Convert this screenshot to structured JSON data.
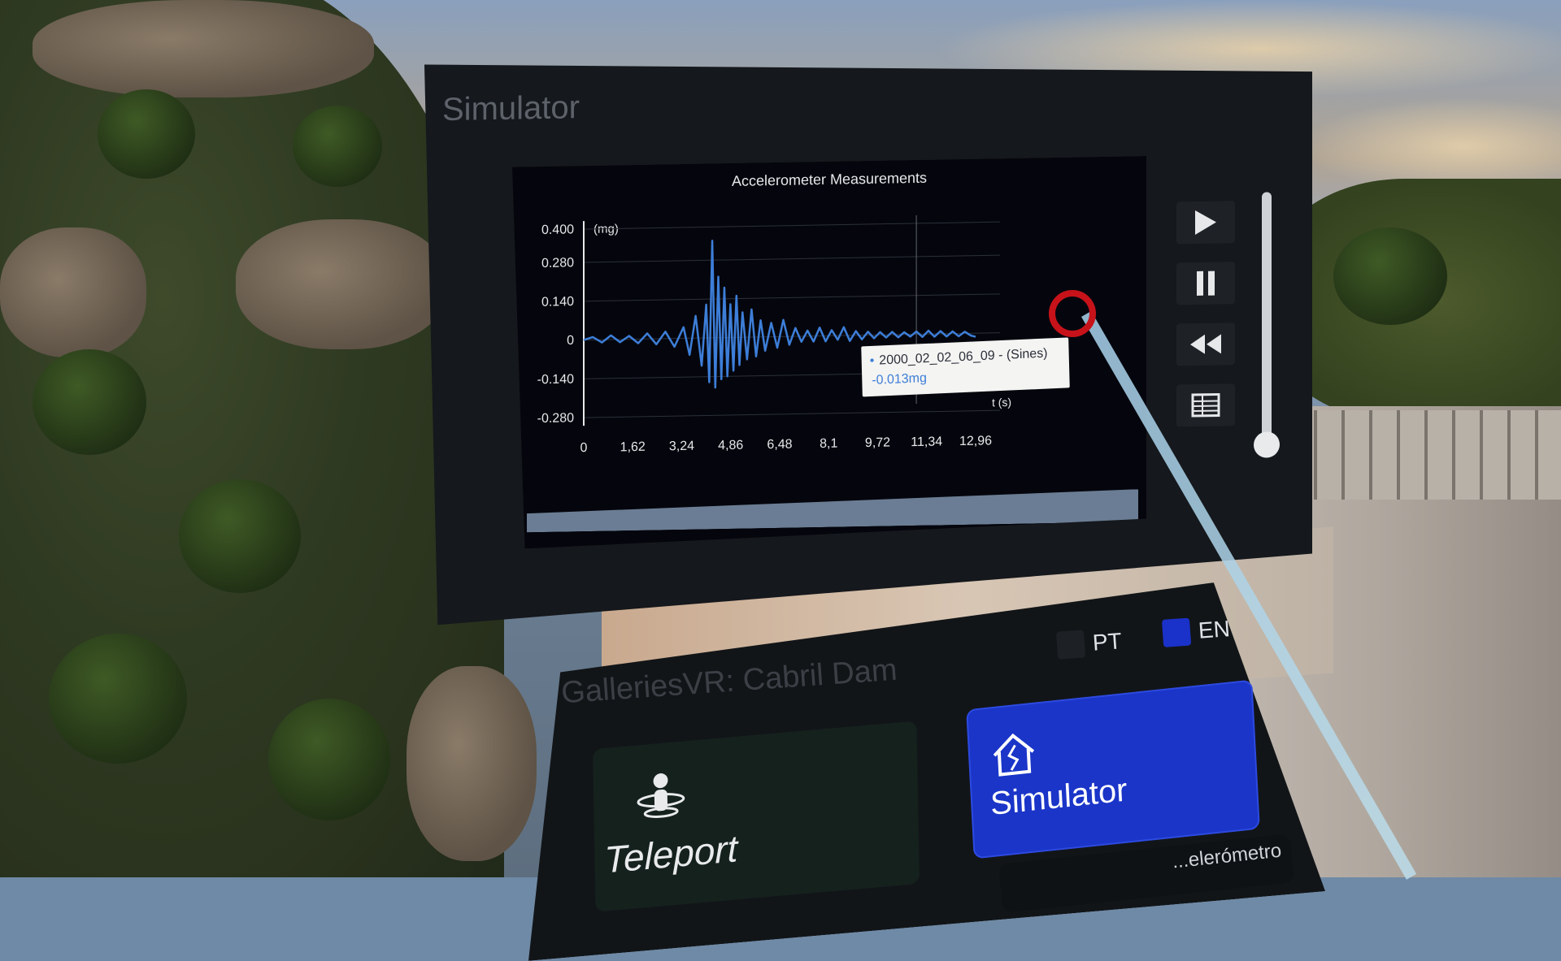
{
  "simulator_panel": {
    "title": "Simulator",
    "controls": {
      "play_icon": "play-icon",
      "pause_icon": "pause-icon",
      "rewind_icon": "rewind-icon",
      "table_icon": "table-icon"
    },
    "volume_slider_level": 0.0
  },
  "chart_data": {
    "type": "line",
    "title": "Accelerometer Measurements",
    "yunit": "(mg)",
    "xunit": "t (s)",
    "y_ticks": [
      "0.400",
      "0.280",
      "0.140",
      "0",
      "-0.140",
      "-0.280"
    ],
    "x_ticks": [
      "0",
      "1,62",
      "3,24",
      "4,86",
      "6,48",
      "8,1",
      "9,72",
      "11,34",
      "12,96"
    ],
    "ylim": [
      -0.28,
      0.4
    ],
    "xlim": [
      0,
      12.96
    ],
    "grid": true,
    "series": [
      {
        "name": "2000_02_02_06_09 - (Sines)",
        "color": "#3d7ed8",
        "x": [
          0,
          0.3,
          0.6,
          0.9,
          1.2,
          1.5,
          1.8,
          2.1,
          2.4,
          2.7,
          3.0,
          3.3,
          3.5,
          3.7,
          3.9,
          4.05,
          4.15,
          4.25,
          4.35,
          4.45,
          4.55,
          4.65,
          4.75,
          4.85,
          4.95,
          5.05,
          5.15,
          5.25,
          5.4,
          5.55,
          5.7,
          5.85,
          6.0,
          6.2,
          6.4,
          6.6,
          6.8,
          7.0,
          7.2,
          7.4,
          7.6,
          7.8,
          8.0,
          8.2,
          8.4,
          8.6,
          8.8,
          9.0,
          9.2,
          9.4,
          9.6,
          9.8,
          10.0,
          10.2,
          10.4,
          10.6,
          10.8,
          11.0,
          11.2,
          11.4,
          11.6,
          11.8,
          12.0,
          12.2,
          12.4,
          12.6,
          12.8,
          12.96
        ],
        "y": [
          0.0,
          0.01,
          -0.01,
          0.015,
          -0.01,
          0.012,
          -0.015,
          0.02,
          -0.02,
          0.025,
          -0.03,
          0.04,
          -0.06,
          0.08,
          -0.1,
          0.12,
          -0.16,
          0.35,
          -0.18,
          0.22,
          -0.15,
          0.18,
          -0.14,
          0.12,
          -0.12,
          0.15,
          -0.1,
          0.09,
          -0.08,
          0.1,
          -0.07,
          0.06,
          -0.05,
          0.05,
          -0.04,
          0.06,
          -0.03,
          0.03,
          -0.02,
          0.02,
          -0.02,
          0.03,
          -0.02,
          0.02,
          -0.015,
          0.03,
          -0.02,
          0.015,
          -0.015,
          0.012,
          -0.012,
          0.01,
          -0.01,
          0.01,
          -0.01,
          0.008,
          -0.008,
          0.01,
          -0.01,
          0.012,
          -0.01,
          0.01,
          -0.01,
          0.008,
          -0.01,
          0.006,
          -0.008,
          -0.013
        ]
      }
    ],
    "tooltip": {
      "series_label": "2000_02_02_06_09 - (Sines)",
      "value": "-0.013mg"
    }
  },
  "menu_panel": {
    "title": "GalleriesVR: Cabril Dam",
    "languages": [
      {
        "code": "PT",
        "selected": false
      },
      {
        "code": "EN",
        "selected": true
      }
    ],
    "buttons": {
      "teleport_label": "Teleport",
      "simulator_label": "Simulator",
      "third_label_partial": "...elerómetro"
    },
    "colors": {
      "accent": "#1a35c8",
      "laser": "#a8d4ea",
      "reticle": "#c7121a"
    }
  }
}
